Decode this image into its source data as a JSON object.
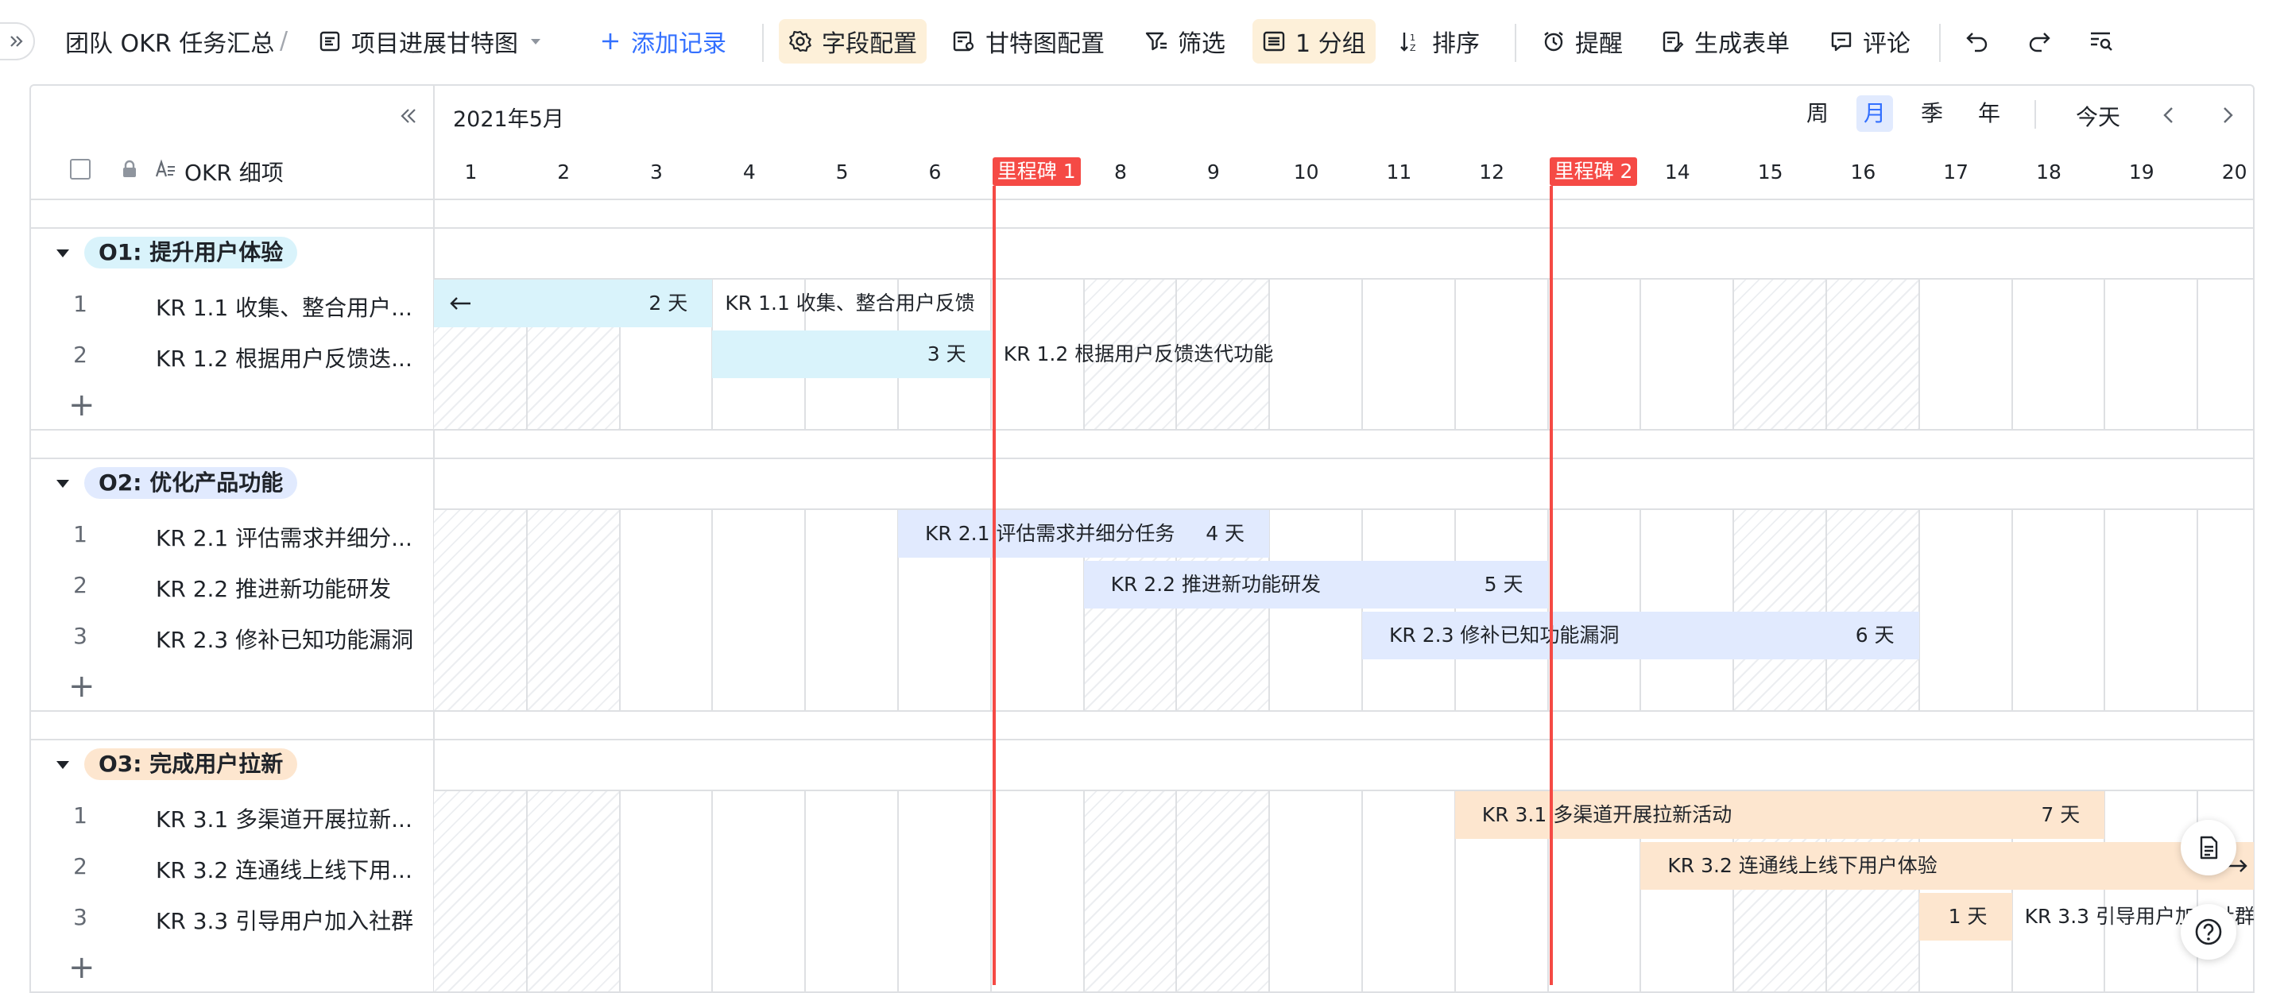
{
  "toolbar": {
    "doc_title": "团队 OKR 任务汇总",
    "separator": "/",
    "view_name": "项目进展甘特图",
    "add_record": "添加记录",
    "field_config": "字段配置",
    "gantt_config": "甘特图配置",
    "filter": "筛选",
    "group": "1 分组",
    "sort": "排序",
    "reminder": "提醒",
    "form": "生成表单",
    "comment": "评论"
  },
  "header": {
    "month_label": "2021年5月",
    "column_title": "OKR 细项",
    "scale_options": [
      "周",
      "月",
      "季",
      "年"
    ],
    "active_scale": "月",
    "today": "今天",
    "days": [
      "1",
      "2",
      "3",
      "4",
      "5",
      "6",
      "7",
      "8",
      "9",
      "10",
      "11",
      "12",
      "13",
      "14",
      "15",
      "16",
      "17",
      "18",
      "19",
      "20"
    ],
    "milestones": [
      "里程碑 1",
      "里程碑 2"
    ]
  },
  "groups": [
    {
      "title": "O1: 提升用户体验",
      "color": "#d9f3fb",
      "rows": [
        {
          "num": "1",
          "title": "KR 1.1 收集、整合用户...",
          "bar_name": "KR 1.1 收集、整合用户反馈",
          "duration": "2 天"
        },
        {
          "num": "2",
          "title": "KR 1.2 根据用户反馈迭...",
          "bar_name": "KR 1.2 根据用户反馈迭代功能",
          "duration": "3 天"
        }
      ]
    },
    {
      "title": "O2: 优化产品功能",
      "color": "#e1eafe",
      "rows": [
        {
          "num": "1",
          "title": "KR 2.1 评估需求并细分...",
          "bar_name": "KR 2.1 评估需求并细分任务",
          "duration": "4 天"
        },
        {
          "num": "2",
          "title": "KR 2.2 推进新功能研发",
          "bar_name": "KR 2.2 推进新功能研发",
          "duration": "5 天"
        },
        {
          "num": "3",
          "title": "KR 2.3 修补已知功能漏洞",
          "bar_name": "KR 2.3 修补已知功能漏洞",
          "duration": "6 天"
        }
      ]
    },
    {
      "title": "O3: 完成用户拉新",
      "color": "#fde6cf",
      "rows": [
        {
          "num": "1",
          "title": "KR 3.1 多渠道开展拉新...",
          "bar_name": "KR 3.1 多渠道开展拉新活动",
          "duration": "7 天"
        },
        {
          "num": "2",
          "title": "KR 3.2 连通线上线下用...",
          "bar_name": "KR 3.2 连通线上线下用户体验",
          "duration": ""
        },
        {
          "num": "3",
          "title": "KR 3.3 引导用户加入社群",
          "bar_name": "KR 3.3 引导用户加入社群",
          "duration": "1 天"
        }
      ]
    }
  ],
  "colors": {
    "accent": "#3370ff",
    "milestone": "#f54a45",
    "highlight_bg": "#fdf0d9",
    "o1_bar": "#d9f3fb",
    "o2_bar": "#e1eafe",
    "o3_bar": "#fde6cf"
  }
}
